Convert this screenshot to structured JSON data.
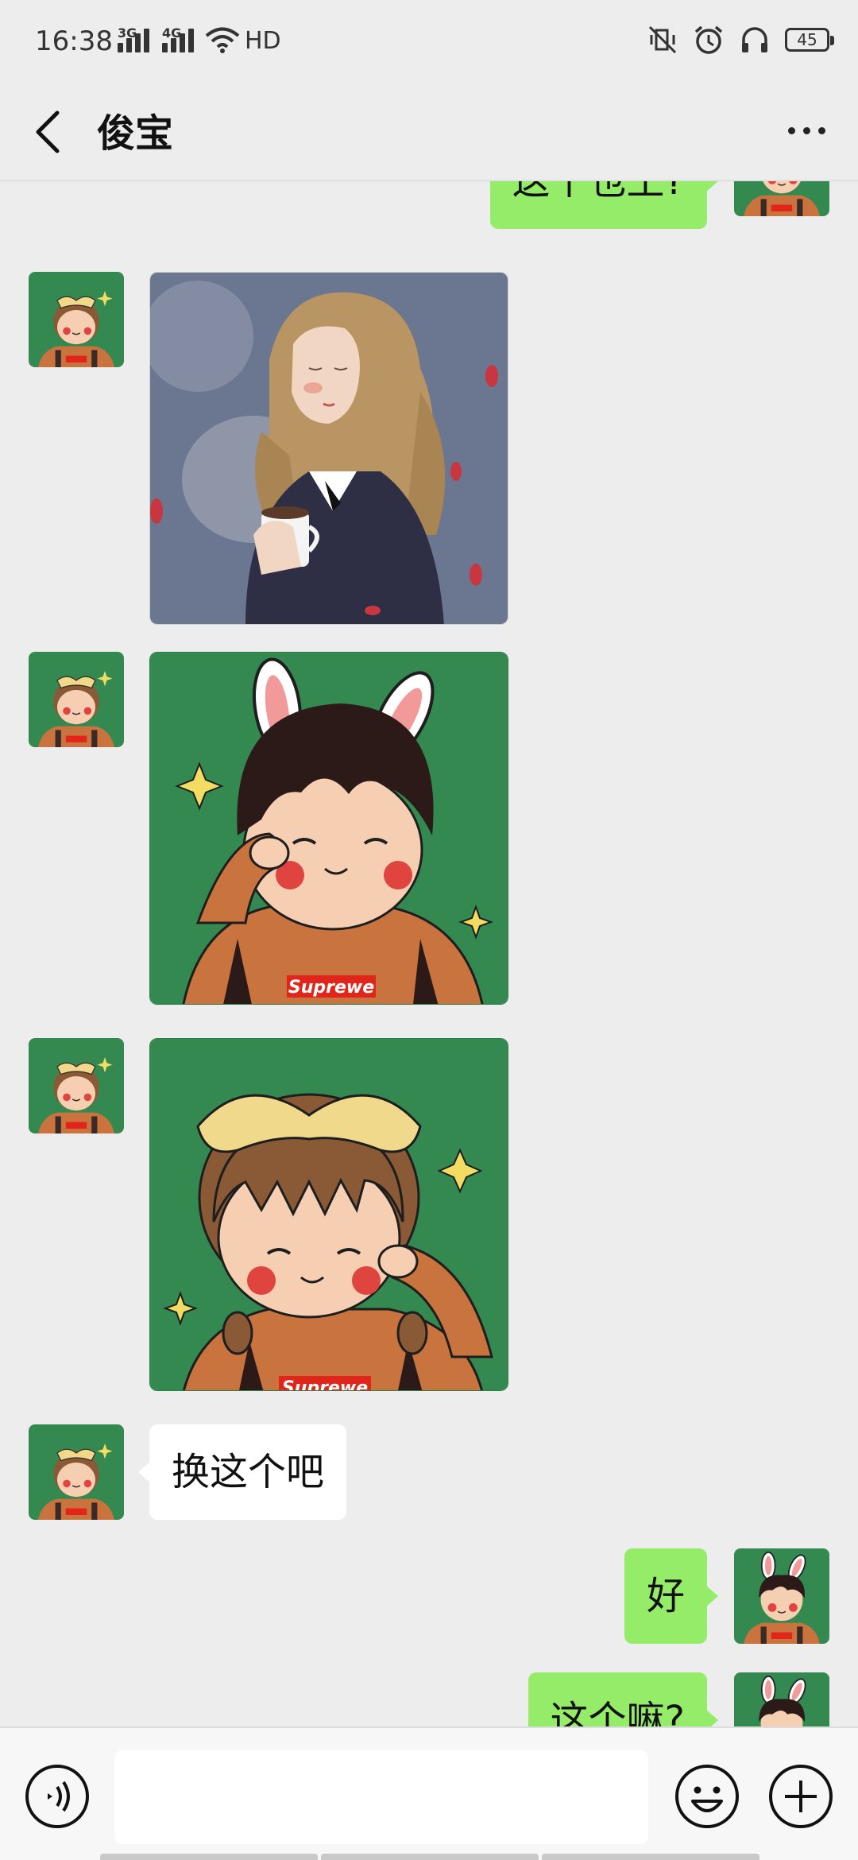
{
  "status_bar": {
    "time": "16:38",
    "signal_1_label": "3G",
    "signal_2_label": "4G",
    "hd_label": "HD",
    "battery_level": "45"
  },
  "nav": {
    "title": "俊宝",
    "back_icon": "chevron-left-icon",
    "more_icon": "more-dots-icon"
  },
  "messages": [
    {
      "side": "sent",
      "type": "text",
      "text": "这个也土?"
    },
    {
      "side": "received",
      "type": "image",
      "image": "girl-with-coffee-illustration"
    },
    {
      "side": "received",
      "type": "image",
      "image": "boy-bunny-ears-supreme-avatar"
    },
    {
      "side": "received",
      "type": "image",
      "image": "girl-yellow-bow-supreme-avatar"
    },
    {
      "side": "received",
      "type": "text",
      "text": "换这个吧"
    },
    {
      "side": "sent",
      "type": "text",
      "text": "好"
    },
    {
      "side": "sent",
      "type": "text",
      "text": "这个嘛?"
    }
  ],
  "sticker_text": {
    "brand": "Suprewe"
  },
  "input_bar": {
    "value": "",
    "placeholder": "",
    "voice_icon": "voice-icon",
    "emoji_icon": "emoji-icon",
    "plus_icon": "plus-icon"
  },
  "colors": {
    "background": "#ededed",
    "sent_bubble": "#95ec69",
    "received_bubble": "#ffffff",
    "avatar_green": "#33894f",
    "shirt_orange": "#c9733f",
    "brand_red": "#e1251b"
  }
}
